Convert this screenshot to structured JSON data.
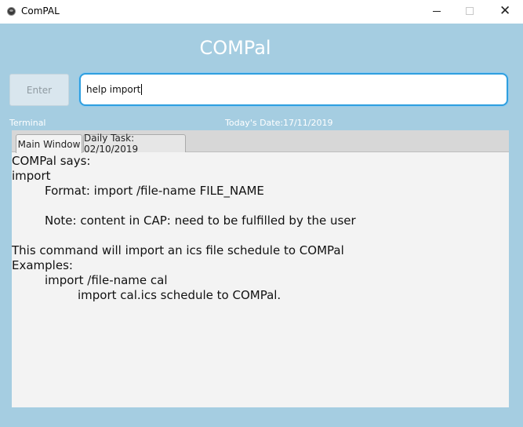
{
  "window": {
    "title": "ComPAL",
    "minimize": "—",
    "maximize": "☐",
    "close": "✕"
  },
  "app_title": "COMPal",
  "enter_button": "Enter",
  "command_input": {
    "value": "help import"
  },
  "terminal_label": "Terminal",
  "date_label": "Today's Date:17/11/2019",
  "tabs": [
    {
      "label": "Main Window",
      "selected": true
    },
    {
      "label": "Daily Task: 02/10/2019",
      "selected": false
    }
  ],
  "output_lines": [
    "COMPal says:",
    "import",
    "Format: import /file-name FILE_NAME",
    "",
    "Note: content in CAP: need to be fulfilled by the user",
    "",
    "This command will import an ics file schedule to COMPal",
    "Examples:",
    "import /file-name cal",
    "import cal.ics schedule to COMPal."
  ],
  "colors": {
    "background": "#a5cde1",
    "input_border": "#2f9fdf",
    "tab_content": "#f3f3f3"
  }
}
